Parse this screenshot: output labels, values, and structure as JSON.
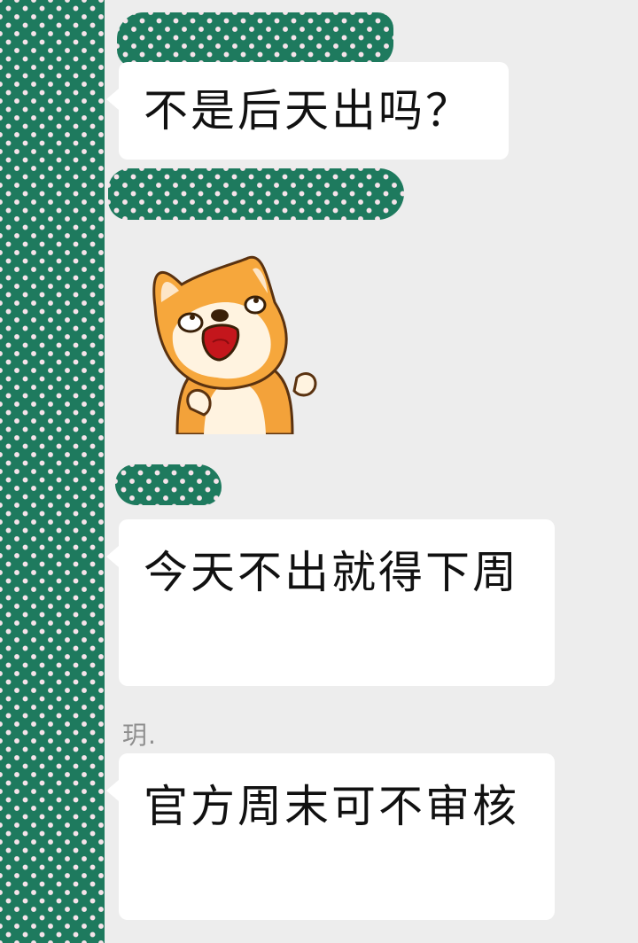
{
  "chat": {
    "messages": [
      {
        "type": "text",
        "text": "不是后天出吗？"
      },
      {
        "type": "sticker",
        "sticker": "shiba-dog-sticker"
      },
      {
        "type": "text",
        "text": "今天不出就得下周"
      },
      {
        "type": "text",
        "sender": "玥.",
        "text": "官方周末可不审核"
      }
    ]
  },
  "colors": {
    "background": "#ededed",
    "bubble": "#ffffff",
    "redaction": "#1e7a5e",
    "sender_name": "#8e8e8e"
  },
  "icons": {
    "sticker": "shiba-dog-sticker"
  }
}
